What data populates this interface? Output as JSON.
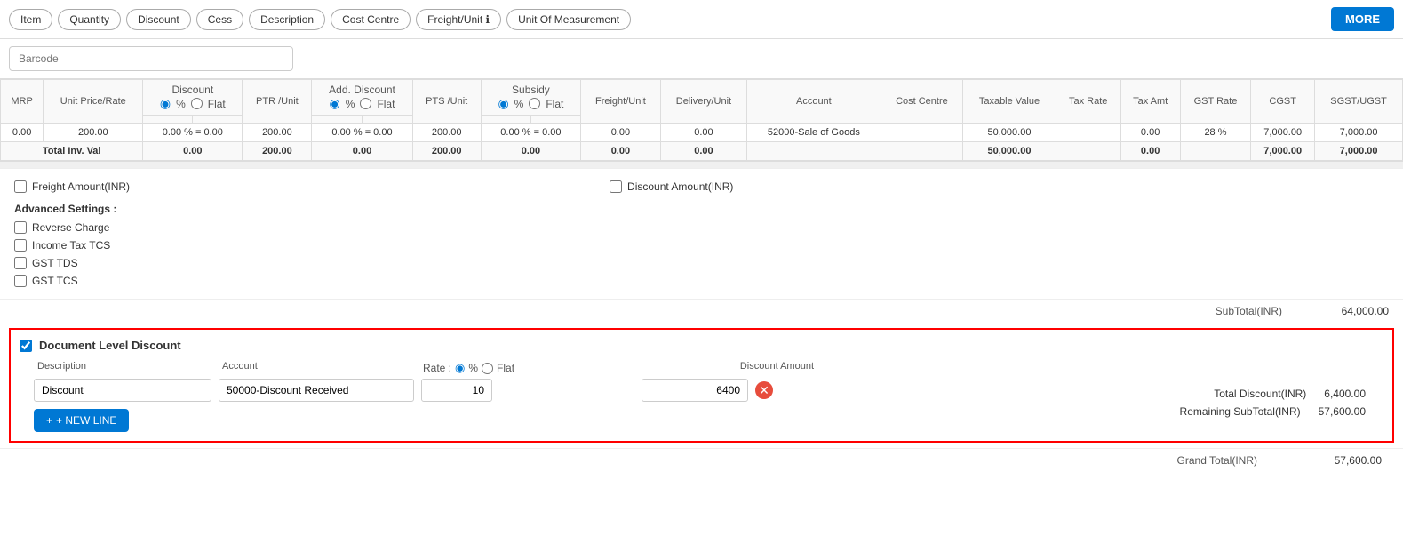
{
  "toolbar": {
    "buttons": [
      "Item",
      "Quantity",
      "Discount",
      "Cess",
      "Description",
      "Cost Centre",
      "Freight/Unit ℹ",
      "Unit Of Measurement"
    ],
    "more_label": "MORE"
  },
  "barcode": {
    "placeholder": "Barcode"
  },
  "table": {
    "headers": {
      "mrp": "MRP",
      "unit_price": "Unit Price/Rate",
      "discount_label": "Discount",
      "discount_pct": "%",
      "discount_flat": "Flat",
      "ptr_unit": "PTR /Unit",
      "add_discount": "Add. Discount",
      "add_pct": "%",
      "add_flat": "Flat",
      "pts_unit": "PTS /Unit",
      "subsidy": "Subsidy",
      "sub_pct": "%",
      "sub_flat": "Flat",
      "freight_unit": "Freight/Unit",
      "delivery_unit": "Delivery/Unit",
      "account": "Account",
      "cost_centre": "Cost Centre",
      "taxable_value": "Taxable Value",
      "tax_rate": "Tax Rate",
      "tax_amt": "Tax Amt",
      "gst_rate": "GST Rate",
      "cgst": "CGST",
      "sgst": "SGST/UGST"
    },
    "data_row": {
      "mrp": "0.00",
      "unit_price": "200.00",
      "discount": "0.00 % = 0.00",
      "ptr_unit": "200.00",
      "add_discount": "0.00 % = 0.00",
      "pts_unit": "200.00",
      "subsidy": "0.00 % = 0.00",
      "freight_unit": "0.00",
      "delivery_unit": "0.00",
      "account": "52000-Sale of Goods",
      "cost_centre": "",
      "taxable_value": "50,000.00",
      "tax_rate": "",
      "tax_amt": "0.00",
      "gst_rate": "28 %",
      "cgst": "7,000.00",
      "sgst": "7,000.00"
    },
    "total_row": {
      "label": "Total Inv. Val",
      "values": [
        "0.00",
        "200.00",
        "0.00",
        "200.00",
        "0.00",
        "0.00",
        "0.00",
        "50,000.00",
        "0.00",
        "7,000.00",
        "7,000.00"
      ]
    }
  },
  "options": {
    "freight_amount": "Freight Amount(INR)",
    "discount_amount": "Discount Amount(INR)",
    "advanced_settings_label": "Advanced Settings :",
    "checkboxes": [
      "Reverse Charge",
      "Income Tax TCS",
      "GST TDS",
      "GST TCS"
    ]
  },
  "subtotal": {
    "label": "SubTotal(INR)",
    "value": "64,000.00"
  },
  "discount_section": {
    "checked": true,
    "label": "Document Level Discount",
    "col_headers": {
      "description": "Description",
      "account": "Account",
      "rate": "Rate :",
      "pct": "%",
      "flat": "Flat",
      "discount_amount": "Discount Amount"
    },
    "row": {
      "description": "Discount",
      "account": "50000-Discount Received",
      "rate_value": "10",
      "discount_amount": "6400"
    },
    "new_line_label": "+ NEW LINE",
    "total_discount_label": "Total Discount(INR)",
    "total_discount_value": "6,400.00",
    "remaining_label": "Remaining SubTotal(INR)",
    "remaining_value": "57,600.00"
  },
  "grand_total": {
    "label": "Grand Total(INR)",
    "value": "57,600.00"
  }
}
